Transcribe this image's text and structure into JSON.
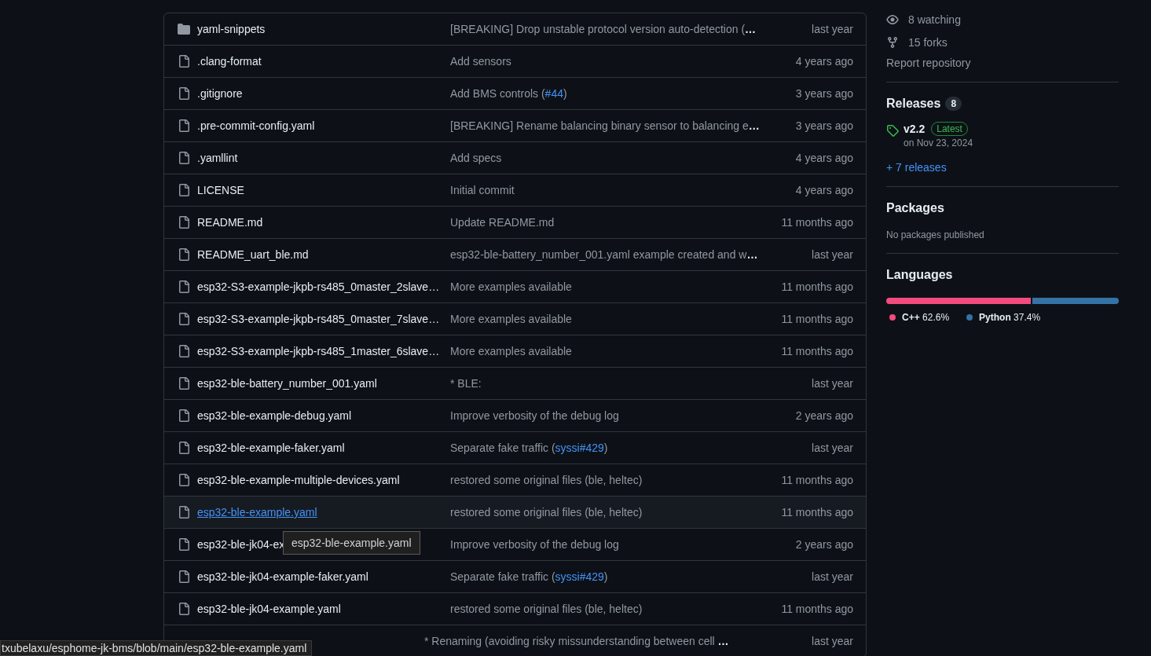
{
  "files": [
    {
      "kind": "dir",
      "name": "yaml-snippets",
      "message": [
        {
          "text": "[BREAKING] Drop unstable protocol version auto-detection (",
          "link": false
        },
        {
          "text": "…",
          "link": false,
          "kind": "more"
        }
      ],
      "time": "last year",
      "hovered": false
    },
    {
      "kind": "file",
      "name": ".clang-format",
      "message": [
        {
          "text": "Add sensors",
          "link": false
        }
      ],
      "time": "4 years ago",
      "hovered": false
    },
    {
      "kind": "file",
      "name": ".gitignore",
      "message": [
        {
          "text": "Add BMS controls (",
          "link": false
        },
        {
          "text": "#44",
          "link": true
        },
        {
          "text": ")",
          "link": false
        }
      ],
      "time": "3 years ago",
      "hovered": false
    },
    {
      "kind": "file",
      "name": ".pre-commit-config.yaml",
      "message": [
        {
          "text": "[BREAKING] Rename balancing binary sensor to balancing e",
          "link": false
        },
        {
          "text": "…",
          "link": false,
          "kind": "more"
        }
      ],
      "time": "3 years ago",
      "hovered": false
    },
    {
      "kind": "file",
      "name": ".yamllint",
      "message": [
        {
          "text": "Add specs",
          "link": false
        }
      ],
      "time": "4 years ago",
      "hovered": false
    },
    {
      "kind": "file",
      "name": "LICENSE",
      "message": [
        {
          "text": "Initial commit",
          "link": false
        }
      ],
      "time": "4 years ago",
      "hovered": false
    },
    {
      "kind": "file",
      "name": "README.md",
      "message": [
        {
          "text": "Update README.md",
          "link": false
        }
      ],
      "time": "11 months ago",
      "hovered": false
    },
    {
      "kind": "file",
      "name": "README_uart_ble.md",
      "message": [
        {
          "text": "esp32-ble-battery_number_001.yaml example created and w",
          "link": false
        },
        {
          "text": "…",
          "link": false,
          "kind": "more"
        }
      ],
      "time": "last year",
      "hovered": false
    },
    {
      "kind": "file",
      "name": "esp32-S3-example-jkpb-rs485_0master_2slave…",
      "message": [
        {
          "text": "More examples available",
          "link": false
        }
      ],
      "time": "11 months ago",
      "hovered": false
    },
    {
      "kind": "file",
      "name": "esp32-S3-example-jkpb-rs485_0master_7slave…",
      "message": [
        {
          "text": "More examples available",
          "link": false
        }
      ],
      "time": "11 months ago",
      "hovered": false
    },
    {
      "kind": "file",
      "name": "esp32-S3-example-jkpb-rs485_1master_6slave…",
      "message": [
        {
          "text": "More examples available",
          "link": false
        }
      ],
      "time": "11 months ago",
      "hovered": false
    },
    {
      "kind": "file",
      "name": "esp32-ble-battery_number_001.yaml",
      "message": [
        {
          "text": "* BLE:",
          "link": false
        }
      ],
      "time": "last year",
      "hovered": false
    },
    {
      "kind": "file",
      "name": "esp32-ble-example-debug.yaml",
      "message": [
        {
          "text": "Improve verbosity of the debug log",
          "link": false
        }
      ],
      "time": "2 years ago",
      "hovered": false
    },
    {
      "kind": "file",
      "name": "esp32-ble-example-faker.yaml",
      "message": [
        {
          "text": "Separate fake traffic (",
          "link": false
        },
        {
          "text": "syssi#429",
          "link": true
        },
        {
          "text": ")",
          "link": false
        }
      ],
      "time": "last year",
      "hovered": false
    },
    {
      "kind": "file",
      "name": "esp32-ble-example-multiple-devices.yaml",
      "message": [
        {
          "text": "restored some original files (ble, heltec)",
          "link": false
        }
      ],
      "time": "11 months ago",
      "hovered": false
    },
    {
      "kind": "file",
      "name": "esp32-ble-example.yaml",
      "message": [
        {
          "text": "restored some original files (ble, heltec)",
          "link": false
        }
      ],
      "time": "11 months ago",
      "hovered": true,
      "tooltip": "esp32-ble-example.yaml"
    },
    {
      "kind": "file",
      "name": "esp32-ble-jk04-ex",
      "message": [
        {
          "text": "Improve verbosity of the debug log",
          "link": false
        }
      ],
      "time": "2 years ago",
      "hovered": false
    },
    {
      "kind": "file",
      "name": "esp32-ble-jk04-example-faker.yaml",
      "message": [
        {
          "text": "Separate fake traffic (",
          "link": false
        },
        {
          "text": "syssi#429",
          "link": true
        },
        {
          "text": ")",
          "link": false
        }
      ],
      "time": "last year",
      "hovered": false
    },
    {
      "kind": "file",
      "name": "esp32-ble-jk04-example.yaml",
      "message": [
        {
          "text": "restored some original files (ble, heltec)",
          "link": false
        }
      ],
      "time": "11 months ago",
      "hovered": false
    },
    {
      "message": [
        {
          "text": "* Renaming (avoiding risky missunderstanding between cell ",
          "link": false
        },
        {
          "text": "…",
          "link": false,
          "kind": "more"
        }
      ],
      "time": "last year"
    }
  ],
  "sidebar": {
    "stats": [
      {
        "kind": "eye",
        "label": "8 watching"
      },
      {
        "kind": "fork",
        "label": "15 forks"
      }
    ],
    "report": "Report repository",
    "releases": {
      "title": "Releases",
      "count": "8",
      "latest": {
        "tag": "v2.2",
        "badge": "Latest",
        "date": "on Nov 23, 2024"
      },
      "more": "+ 7 releases"
    },
    "packages": {
      "title": "Packages",
      "note": "No packages published"
    },
    "languages": {
      "title": "Languages",
      "items": [
        {
          "name": "C++",
          "percent": "62.6%",
          "level": 0.626,
          "color": "#f34b7d"
        },
        {
          "name": "Python",
          "percent": "37.4%",
          "level": 0.374,
          "color": "#3572a5"
        }
      ]
    }
  },
  "status_bar": "txubelaxu/esphome-jk-bms/blob/main/esp32-ble-example.yaml"
}
